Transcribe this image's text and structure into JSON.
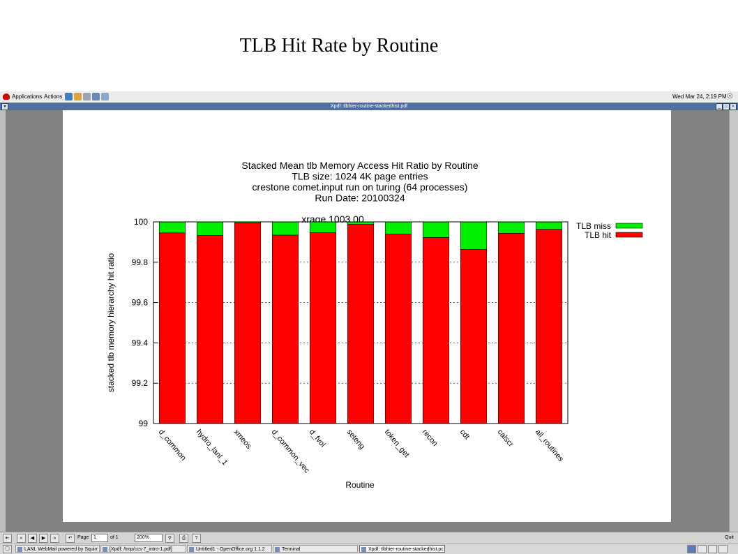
{
  "slide": {
    "title": "TLB Hit Rate by Routine"
  },
  "top_panel": {
    "applications": "Applications",
    "actions": "Actions",
    "clock": "Wed Mar 24,  2:19 PM"
  },
  "window": {
    "title": "Xpdf: tlbhier-routine-stackedhist.pdf"
  },
  "toolbar": {
    "page_label": "Page",
    "page_value": "1",
    "of_pages": "of 1",
    "zoom": "200%",
    "quit": "Quit"
  },
  "taskbar": {
    "tasks": [
      "LANL WebMail powered by Squirr",
      "[Xpdf: /tmp/ccs-7_intro-1.pdf]",
      "Untitled1 - OpenOffice.org 1.1.2",
      "Terminal",
      "Xpdf: tlbhier-routine-stackedhist.pc"
    ]
  },
  "colors": {
    "hit": "#ff0000",
    "miss": "#00ee00",
    "titlebar": "#4f6fa5"
  },
  "chart_data": {
    "type": "bar",
    "stacked": true,
    "title": [
      "Stacked Mean tlb Memory Access Hit Ratio by Routine",
      "TLB size: 1024 4K page entries",
      "crestone comet.input run on turing (64 processes)",
      "Run Date: 20100324"
    ],
    "annotation": "xrage 1003.00",
    "xlabel": "Routine",
    "ylabel": "stacked tlb memory hierarchy hit ratio",
    "ylim": [
      99,
      100
    ],
    "yticks": [
      "99",
      "99.2",
      "99.4",
      "99.6",
      "99.8",
      "100"
    ],
    "grid": true,
    "legend_position": "top-right",
    "categories": [
      "d_common",
      "hydro_lanl_1",
      "xmeos",
      "d_common_vec",
      "d_fvol",
      "seteng",
      "token_get",
      "recon",
      "cdt",
      "calscr",
      "all_routines"
    ],
    "series": [
      {
        "name": "TLB hit",
        "color": "#ff0000",
        "values": [
          99.945,
          99.932,
          99.995,
          99.934,
          99.946,
          99.988,
          99.94,
          99.922,
          99.864,
          99.943,
          99.963
        ]
      },
      {
        "name": "TLB miss",
        "color": "#00ee00",
        "values": [
          0.055,
          0.068,
          0.005,
          0.066,
          0.054,
          0.012,
          0.06,
          0.078,
          0.136,
          0.057,
          0.037
        ]
      }
    ]
  }
}
